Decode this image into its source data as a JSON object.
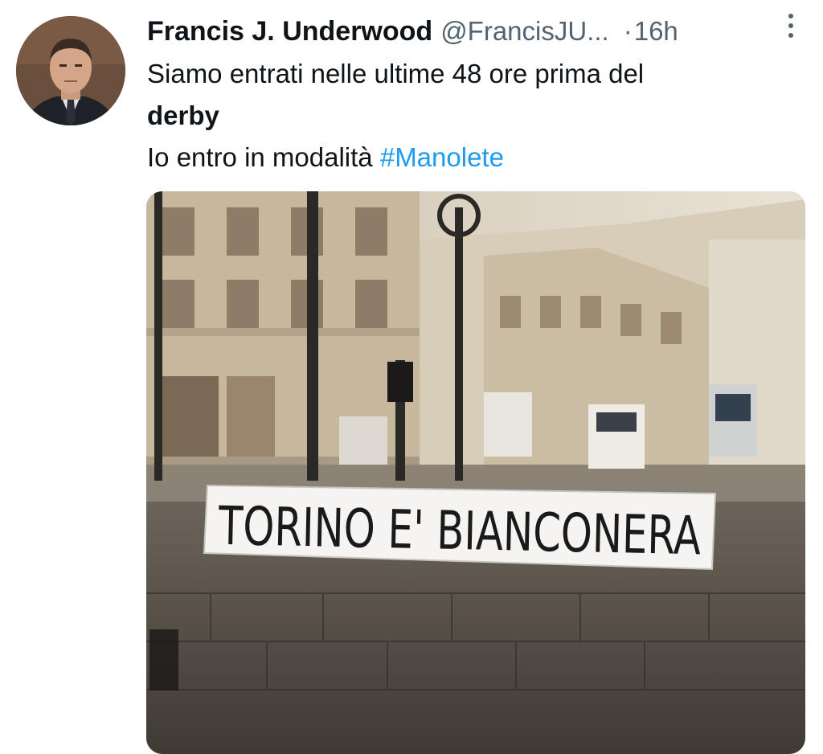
{
  "tweet": {
    "author_name": "Francis J. Underwood",
    "author_handle": "@FrancisJU...",
    "separator": "·",
    "timestamp": "16h",
    "text_line1": "Siamo entrati nelle ultime 48 ore prima del",
    "text_line2_bold": "derby",
    "text_line3_prefix": "Io entro in modalità ",
    "hashtag": "#Manolete"
  },
  "media": {
    "banner_text": "TORINO E' BIANCONERA"
  },
  "icons": {
    "more": "more-vertical-icon"
  },
  "colors": {
    "hashtag": "#1d9bf0",
    "secondary_text": "#536471",
    "primary_text": "#0f1419"
  }
}
